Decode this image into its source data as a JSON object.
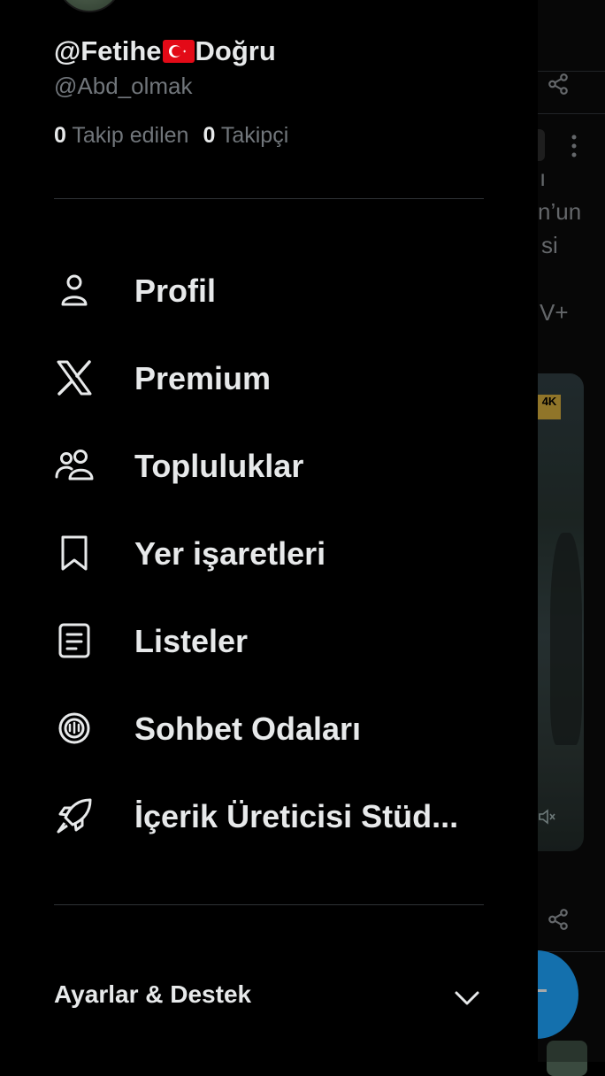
{
  "profile": {
    "name_before": "@Fetihe",
    "name_after": "Doğru",
    "handle": "@Abd_olmak",
    "following_count": "0",
    "following_label": "Takip edilen",
    "followers_count": "0",
    "followers_label": "Takipçi"
  },
  "menu": [
    {
      "label": "Profil",
      "icon": "person-icon"
    },
    {
      "label": "Premium",
      "icon": "x-logo-icon"
    },
    {
      "label": "Topluluklar",
      "icon": "communities-icon"
    },
    {
      "label": "Yer işaretleri",
      "icon": "bookmark-icon"
    },
    {
      "label": "Listeler",
      "icon": "list-icon"
    },
    {
      "label": "Sohbet Odaları",
      "icon": "spaces-icon"
    },
    {
      "label": "İçerik Üreticisi Stüd...",
      "icon": "rocket-icon"
    }
  ],
  "settings": {
    "label": "Ayarlar & Destek",
    "icon": "chevron-down-icon"
  },
  "background_feed": {
    "line1": "ı",
    "line2": "n’un",
    "line3": "si",
    "line4": "V+",
    "badge": "4K"
  },
  "colors": {
    "accent": "#1d9bf0",
    "background": "#000000",
    "text": "#e7e9ea",
    "muted": "#71767b",
    "divider": "#2f3336"
  }
}
